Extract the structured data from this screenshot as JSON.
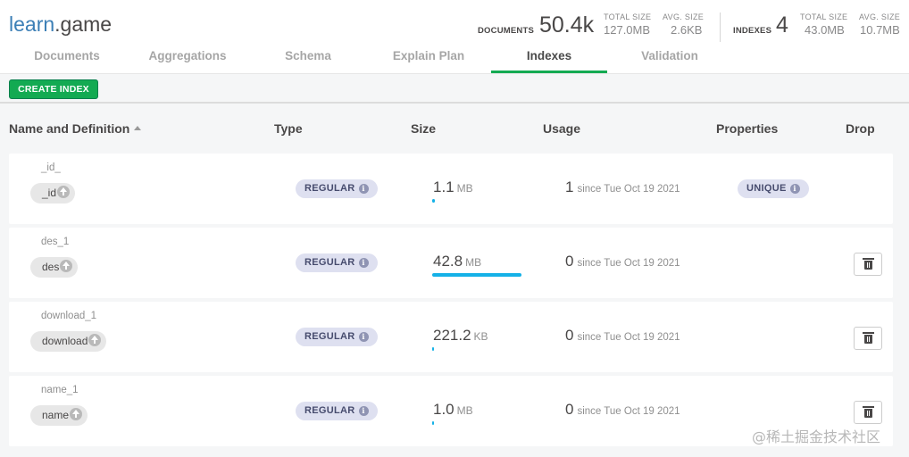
{
  "namespace": {
    "db": "learn",
    "sep": ".",
    "collection": "game"
  },
  "stats": {
    "documents_label": "DOCUMENTS",
    "documents_value": "50.4k",
    "doc_total_size_label": "TOTAL SIZE",
    "doc_total_size_value": "127.0MB",
    "doc_avg_size_label": "AVG. SIZE",
    "doc_avg_size_value": "2.6KB",
    "indexes_label": "INDEXES",
    "indexes_value": "4",
    "idx_total_size_label": "TOTAL SIZE",
    "idx_total_size_value": "43.0MB",
    "idx_avg_size_label": "AVG. SIZE",
    "idx_avg_size_value": "10.7MB"
  },
  "tabs": [
    {
      "label": "Documents"
    },
    {
      "label": "Aggregations"
    },
    {
      "label": "Schema"
    },
    {
      "label": "Explain Plan"
    },
    {
      "label": "Indexes",
      "active": true
    },
    {
      "label": "Validation"
    }
  ],
  "toolbar": {
    "create_index_label": "CREATE INDEX"
  },
  "columns": {
    "name": "Name and Definition",
    "type": "Type",
    "size": "Size",
    "usage": "Usage",
    "properties": "Properties",
    "drop": "Drop"
  },
  "indexes": [
    {
      "name": "_id_",
      "field": "_id",
      "type": "REGULAR",
      "size_value": "1.1",
      "size_unit": "MB",
      "size_fraction": 0.026,
      "usage_count": "1",
      "usage_since": "since Tue Oct 19 2021",
      "property": "UNIQUE",
      "droppable": false
    },
    {
      "name": "des_1",
      "field": "des",
      "type": "REGULAR",
      "size_value": "42.8",
      "size_unit": "MB",
      "size_fraction": 1.0,
      "usage_count": "0",
      "usage_since": "since Tue Oct 19 2021",
      "property": "",
      "droppable": true
    },
    {
      "name": "download_1",
      "field": "download",
      "type": "REGULAR",
      "size_value": "221.2",
      "size_unit": "KB",
      "size_fraction": 0.005,
      "usage_count": "0",
      "usage_since": "since Tue Oct 19 2021",
      "property": "",
      "droppable": true
    },
    {
      "name": "name_1",
      "field": "name",
      "type": "REGULAR",
      "size_value": "1.0",
      "size_unit": "MB",
      "size_fraction": 0.023,
      "usage_count": "0",
      "usage_since": "since Tue Oct 19 2021",
      "property": "",
      "droppable": true
    }
  ],
  "icons": {
    "field": "arrow-up-circle-icon",
    "info": "info-icon",
    "drop": "trash-icon",
    "sort": "sort-ascending-icon"
  },
  "colors": {
    "accent_green": "#13aa52",
    "db_blue": "#3c7fb6",
    "size_bar": "#14b1e7",
    "badge_bg": "#dee0f0"
  },
  "watermark": "@稀土掘金技术社区"
}
